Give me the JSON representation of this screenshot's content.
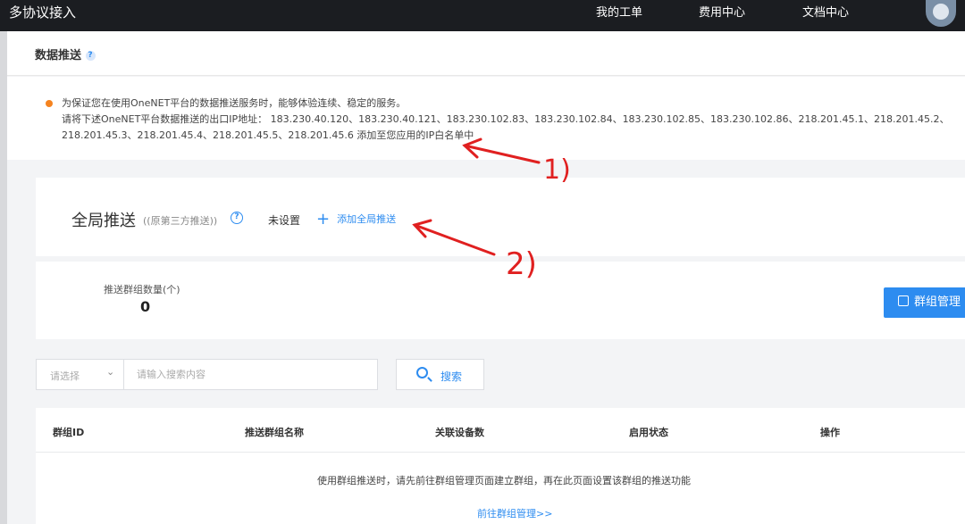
{
  "topbar": {
    "title": "多协议接入",
    "nav": [
      "我的工单",
      "费用中心",
      "文档中心"
    ]
  },
  "header": {
    "title": "数据推送",
    "help": "?"
  },
  "notice": {
    "line1": "为保证您在使用OneNET平台的数据推送服务时，能够体验连续、稳定的服务。",
    "line2": "请将下述OneNET平台数据推送的出口IP地址： 183.230.40.120、183.230.40.121、183.230.102.83、183.230.102.84、183.230.102.85、183.230.102.86、218.201.45.1、218.201.45.2、",
    "line3": "218.201.45.3、218.201.45.4、218.201.45.5、218.201.45.6 添加至您应用的IP白名单中"
  },
  "global_push": {
    "title": "全局推送",
    "subtitle": "((原第三方推送))",
    "help": "?",
    "status": "未设置",
    "add_label": "添加全局推送"
  },
  "group_stats": {
    "count_label": "推送群组数量(个)",
    "count_value": "0",
    "manage_button": "群组管理"
  },
  "search": {
    "select_placeholder": "请选择",
    "chevron": "⌄",
    "input_placeholder": "请输入搜索内容",
    "button_label": "搜索"
  },
  "table": {
    "columns": [
      "群组ID",
      "推送群组名称",
      "关联设备数",
      "启用状态",
      "操作"
    ],
    "empty_text": "使用群组推送时，请先前往群组管理页面建立群组，再在此页面设置该群组的推送功能",
    "goto_link": "前往群组管理>>"
  },
  "annotations": [
    "1)",
    "2)"
  ],
  "colors": {
    "accent": "#2d8cf0",
    "topbar": "#1b1d21",
    "notice_dot": "#f5831f",
    "annotation": "#e02020"
  }
}
